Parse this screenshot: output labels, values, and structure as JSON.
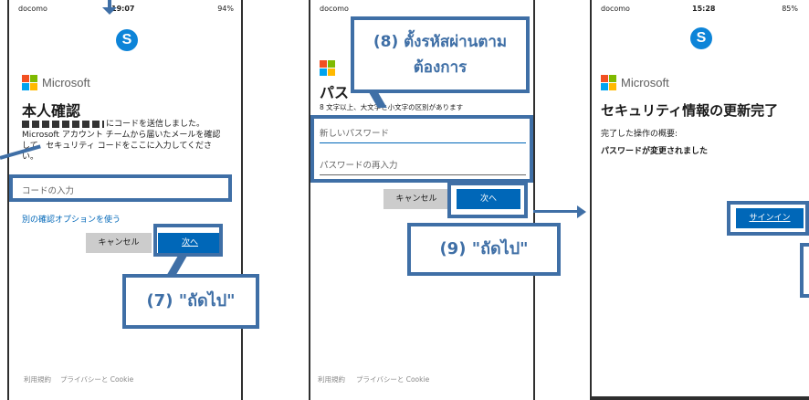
{
  "screen1": {
    "status": {
      "carrier": "docomo",
      "time": "19:07",
      "battery": "94%"
    },
    "brand": "Microsoft",
    "title": "本人確認",
    "instruction": "にコードを送信しました。Microsoft アカウント チームから届いたメールを確認して、セキュリティ コードをここに入力してください。",
    "code_placeholder": "コードの入力",
    "alt_link": "別の確認オプションを使う",
    "cancel_label": "キャンセル",
    "next_label": "次へ",
    "footer_terms": "利用規約",
    "footer_privacy": "プライバシーと Cookie",
    "callout": "(7) \"ถัดไป\""
  },
  "screen2": {
    "status": {
      "carrier": "docomo"
    },
    "title_partial": "パス",
    "hint": "8 文字以上、大文字と小文字の区別があります",
    "new_password_placeholder": "新しいパスワード",
    "reenter_placeholder": "パスワードの再入力",
    "cancel_label": "キャンセル",
    "next_label": "次へ",
    "footer_terms": "利用規約",
    "footer_privacy": "プライバシーと Cookie",
    "callout_top": "(8) ตั้งรหัสผ่านตามต้องการ",
    "callout_bottom": "(9) \"ถัดไป\""
  },
  "screen3": {
    "status": {
      "carrier": "docomo",
      "time": "15:28",
      "battery": "85%"
    },
    "brand": "Microsoft",
    "title": "セキュリティ情報の更新完了",
    "summary": "完了した操作の概要:",
    "result": "パスワードが変更されました",
    "signin_label": "サインイン"
  },
  "colors": {
    "accent": "#3f6fa6",
    "ms_blue": "#0067b8",
    "skype": "#0d84d8"
  }
}
